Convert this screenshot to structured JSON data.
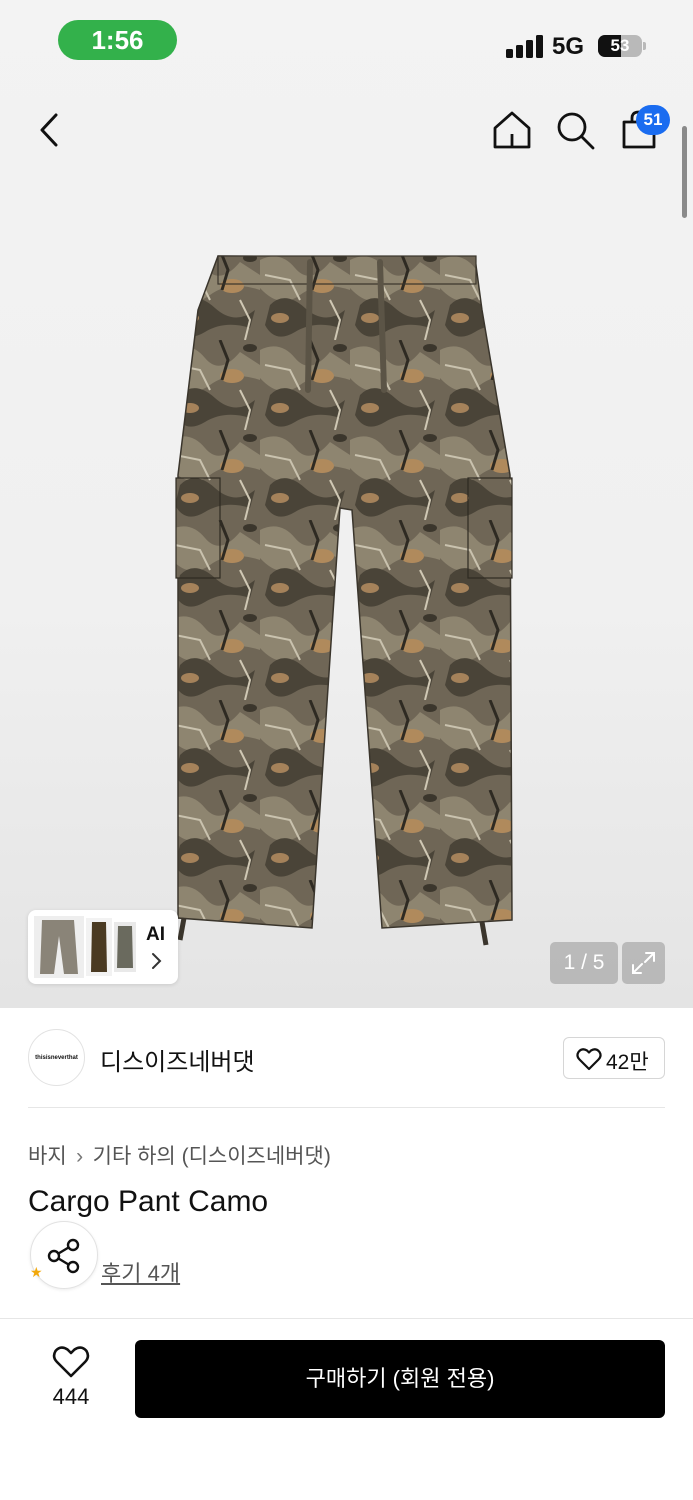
{
  "status_bar": {
    "time": "1:56",
    "network": "5G",
    "battery": "53"
  },
  "nav": {
    "back_icon": "chevron-left-icon",
    "home_icon": "home-icon",
    "search_icon": "search-icon",
    "cart_icon": "shopping-bag-icon",
    "cart_count": "51"
  },
  "gallery": {
    "ai_label": "AI",
    "counter": "1 / 5",
    "expand_icon": "expand-icon",
    "image": "camouflage cargo pants"
  },
  "brand": {
    "logo_text": "thisisneverthat",
    "name": "디스이즈네버댓",
    "like_count": "42만"
  },
  "breadcrumb": {
    "category": "바지",
    "subcategory": "기타 하의 (디스이즈네버댓)"
  },
  "product": {
    "title": "Cargo Pant Camo",
    "reviews": "후기 4개"
  },
  "bottom_bar": {
    "like_count": "444",
    "buy_label": "구매하기 (회원 전용)"
  },
  "colors": {
    "badge": "#1a6cf0",
    "time_pill": "#33b14b",
    "buy_button": "#000000"
  }
}
